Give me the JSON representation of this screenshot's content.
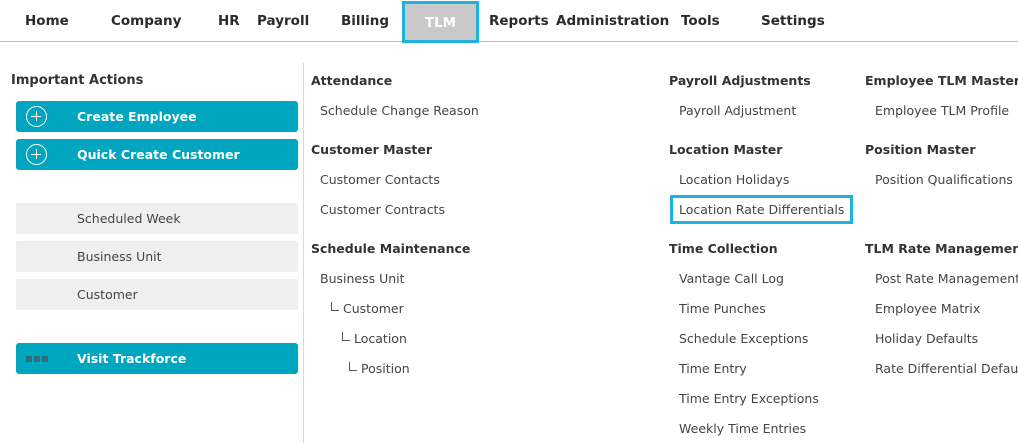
{
  "nav": {
    "items": [
      {
        "label": "Home"
      },
      {
        "label": "Company"
      },
      {
        "label": "HR"
      },
      {
        "label": "Payroll"
      },
      {
        "label": "Billing"
      },
      {
        "label": "TLM",
        "active": true
      },
      {
        "label": "Reports"
      },
      {
        "label": "Administration"
      },
      {
        "label": "Tools"
      },
      {
        "label": "Settings"
      }
    ]
  },
  "sidebar": {
    "title": "Important Actions",
    "primary_actions": [
      {
        "label": "Create Employee",
        "icon": "plus-circle-icon"
      },
      {
        "label": "Quick Create Customer",
        "icon": "plus-circle-icon"
      }
    ],
    "shortcuts": [
      {
        "label": "Scheduled Week"
      },
      {
        "label": "Business Unit"
      },
      {
        "label": "Customer"
      }
    ],
    "visit": {
      "label": "Visit Trackforce",
      "icon": "trackforce-logo-icon"
    }
  },
  "menu": {
    "attendance": {
      "title": "Attendance",
      "links": [
        "Schedule Change Reason"
      ]
    },
    "customer_master": {
      "title": "Customer Master",
      "links": [
        "Customer Contacts",
        "Customer Contracts"
      ]
    },
    "schedule_maintenance": {
      "title": "Schedule Maintenance",
      "links": [
        "Business Unit",
        "Customer",
        "Location",
        "Position"
      ]
    },
    "payroll_adjustments": {
      "title": "Payroll Adjustments",
      "links": [
        "Payroll Adjustment"
      ]
    },
    "location_master": {
      "title": "Location Master",
      "links": [
        "Location Holidays",
        "Location Rate Differentials"
      ]
    },
    "time_collection": {
      "title": "Time Collection",
      "links": [
        "Vantage Call Log",
        "Time Punches",
        "Schedule Exceptions",
        "Time Entry",
        "Time Entry Exceptions",
        "Weekly Time Entries"
      ]
    },
    "employee_tlm_master": {
      "title": "Employee TLM Master",
      "links": [
        "Employee TLM Profile"
      ]
    },
    "position_master": {
      "title": "Position Master",
      "links": [
        "Position Qualifications"
      ]
    },
    "tlm_rate_management": {
      "title": "TLM Rate Management",
      "links": [
        "Post Rate Management",
        "Employee Matrix",
        "Holiday Defaults",
        "Rate Differential Default"
      ]
    }
  },
  "colors": {
    "accent": "#00a6c0",
    "highlight_border": "#1fb3db",
    "active_tab_bg": "#c9c9c9"
  }
}
